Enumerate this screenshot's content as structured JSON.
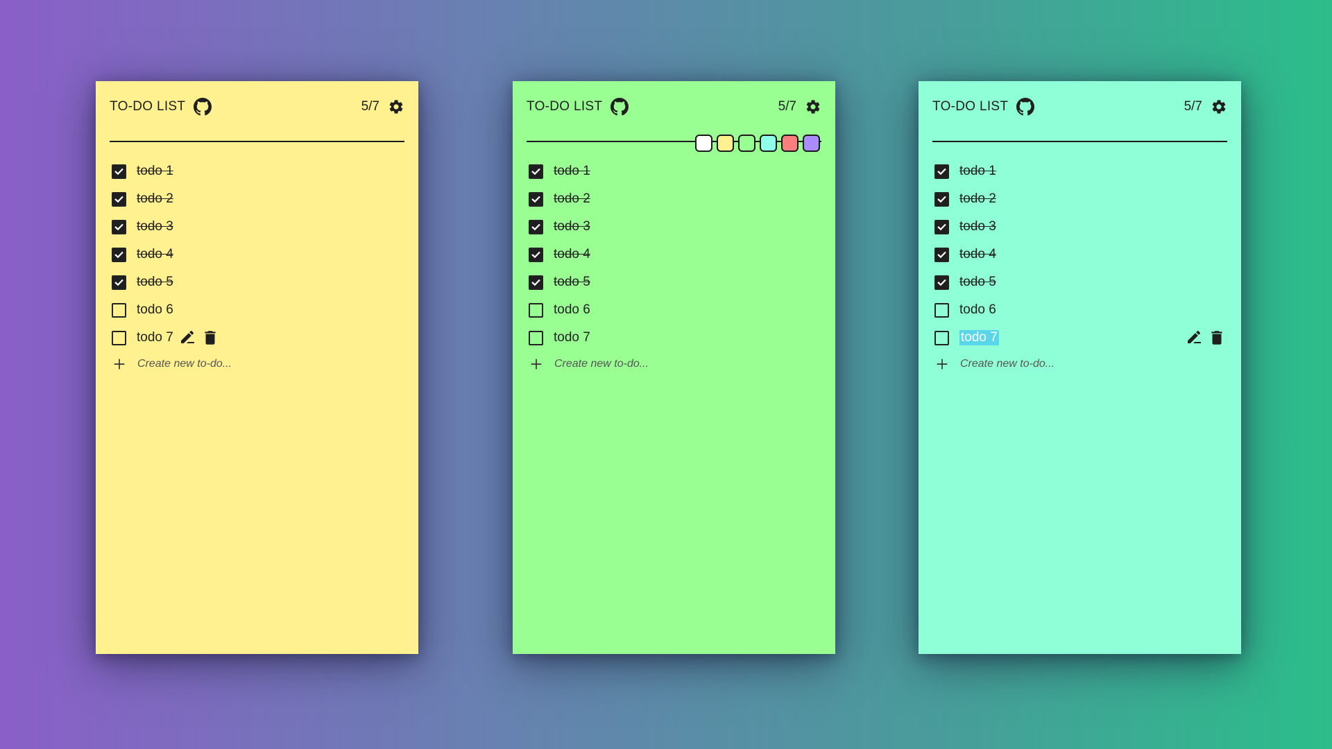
{
  "colors": {
    "yellow": "#fff18f",
    "green": "#99ff93",
    "mint": "#8fffd8",
    "palette": [
      "#ffffff",
      "#fff18f",
      "#99ff93",
      "#8fffe9",
      "#fa7e7e",
      "#a98cff"
    ]
  },
  "icons": {
    "github": "github-icon",
    "settings": "gear-icon",
    "edit": "edit-icon",
    "delete": "trash-icon",
    "add": "plus-icon",
    "check": "check-icon"
  },
  "panels": [
    {
      "title": "TO-DO LIST",
      "count": "5/7",
      "todos": [
        {
          "text": "todo 1",
          "done": true
        },
        {
          "text": "todo 2",
          "done": true
        },
        {
          "text": "todo 3",
          "done": true
        },
        {
          "text": "todo 4",
          "done": true
        },
        {
          "text": "todo 5",
          "done": true
        },
        {
          "text": "todo 6",
          "done": false
        },
        {
          "text": "todo 7",
          "done": false
        }
      ],
      "create_placeholder": "Create new to-do..."
    },
    {
      "title": "TO-DO LIST",
      "count": "5/7",
      "todos": [
        {
          "text": "todo 1",
          "done": true
        },
        {
          "text": "todo 2",
          "done": true
        },
        {
          "text": "todo 3",
          "done": true
        },
        {
          "text": "todo 4",
          "done": true
        },
        {
          "text": "todo 5",
          "done": true
        },
        {
          "text": "todo 6",
          "done": false
        },
        {
          "text": "todo 7",
          "done": false
        }
      ],
      "create_placeholder": "Create new to-do..."
    },
    {
      "title": "TO-DO LIST",
      "count": "5/7",
      "todos": [
        {
          "text": "todo 1",
          "done": true
        },
        {
          "text": "todo 2",
          "done": true
        },
        {
          "text": "todo 3",
          "done": true
        },
        {
          "text": "todo 4",
          "done": true
        },
        {
          "text": "todo 5",
          "done": true
        },
        {
          "text": "todo 6",
          "done": false
        },
        {
          "text": "todo 7",
          "done": false
        }
      ],
      "create_placeholder": "Create new to-do..."
    }
  ]
}
